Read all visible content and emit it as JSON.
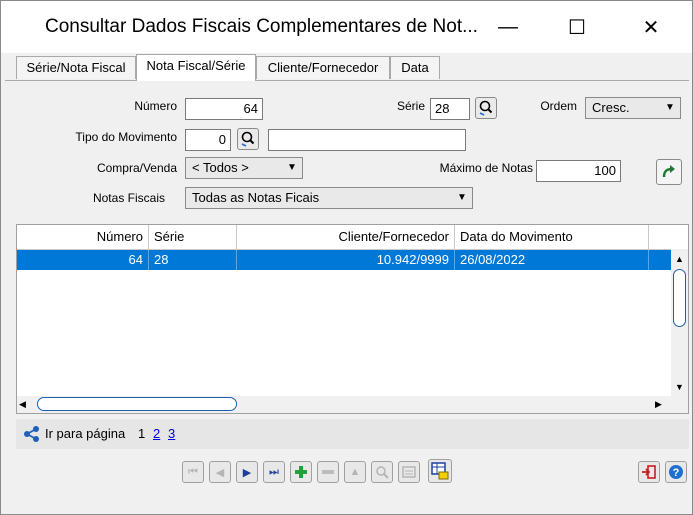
{
  "window": {
    "title": "Consultar Dados Fiscais Complementares de Not...",
    "minimize": "—",
    "maximize": "☐",
    "close": "✕"
  },
  "tabs": [
    {
      "label": "Série/Nota Fiscal"
    },
    {
      "label": "Nota Fiscal/Série"
    },
    {
      "label": "Cliente/Fornecedor"
    },
    {
      "label": "Data"
    }
  ],
  "form": {
    "numero_label": "Número",
    "numero_value": "64",
    "serie_label": "Série",
    "serie_value": "28",
    "ordem_label": "Ordem",
    "ordem_value": "Cresc.",
    "tipo_label": "Tipo do Movimento",
    "tipo_value": "0",
    "tipo_desc": "",
    "compra_label": "Compra/Venda",
    "compra_value": "< Todos >",
    "maximo_label": "Máximo de Notas",
    "maximo_value": "100",
    "notas_label": "Notas Fiscais",
    "notas_value": "Todas as Notas Ficais"
  },
  "grid": {
    "columns": [
      "Número",
      "Série",
      "Cliente/Fornecedor",
      "Data do Movimento"
    ],
    "rows": [
      {
        "numero": "64",
        "serie": "28",
        "cliente": "10.942/9999",
        "data": "26/08/2022"
      }
    ]
  },
  "pager": {
    "label": "Ir para página",
    "pages": [
      "1",
      "2",
      "3"
    ]
  },
  "colors": {
    "selection": "#0078d7",
    "link": "#0000ee"
  }
}
